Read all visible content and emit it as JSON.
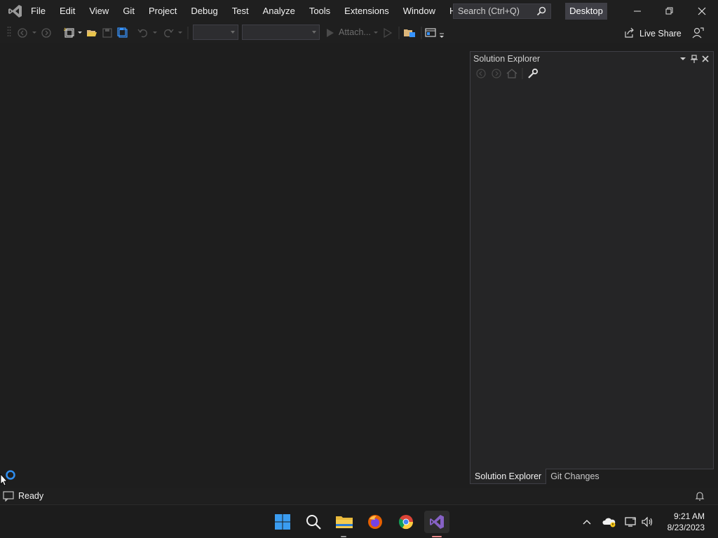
{
  "titlebar": {
    "menu": [
      "File",
      "Edit",
      "View",
      "Git",
      "Project",
      "Debug",
      "Test",
      "Analyze",
      "Tools",
      "Extensions",
      "Window",
      "Help"
    ],
    "search_placeholder": "Search (Ctrl+Q)",
    "desktop_label": "Desktop"
  },
  "toolbar": {
    "attach_label": "Attach...",
    "live_share_label": "Live Share"
  },
  "solution_explorer": {
    "title": "Solution Explorer"
  },
  "bottom_tabs": [
    "Solution Explorer",
    "Git Changes"
  ],
  "status": {
    "text": "Ready"
  },
  "taskbar": {
    "time": "9:21 AM",
    "date": "8/23/2023"
  },
  "colors": {
    "accent": "#0078d4",
    "vs_purple": "#8661c5",
    "background": "#1e1e1e"
  }
}
